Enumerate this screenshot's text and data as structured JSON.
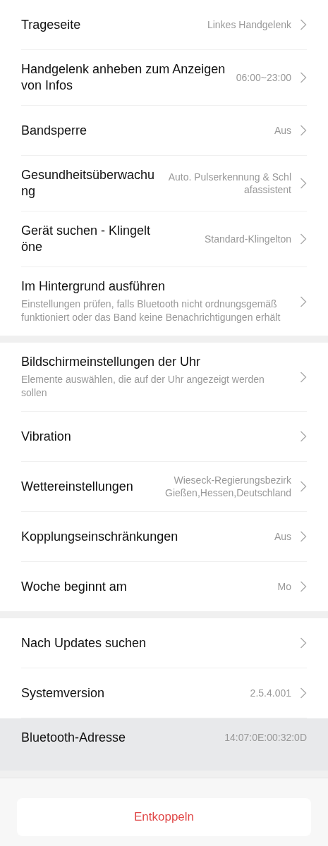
{
  "groups": [
    {
      "rows": [
        {
          "title": "Trageseite",
          "value": "Linkes Handgelenk",
          "chevron": true,
          "highlighted": false
        },
        {
          "title": "Handgelenk anheben zum Anzeigen von Infos",
          "value": "06:00~23:00",
          "chevron": true,
          "highlighted": false
        },
        {
          "title": "Bandsperre",
          "value": "Aus",
          "chevron": true,
          "highlighted": false
        },
        {
          "title": "Gesundheitsüberwachung",
          "value": "Auto. Pulserkennung & Schlafassistent",
          "chevron": true,
          "highlighted": false
        },
        {
          "title": "Gerät suchen - Klingeltöne",
          "value": "Standard-Klingelton",
          "chevron": true,
          "highlighted": false
        },
        {
          "title": "Im Hintergrund ausführen",
          "subtitle": "Einstellungen prüfen, falls Bluetooth nicht ordnungsgemäß funktioniert oder das Band keine Benachrichtigungen erhält",
          "chevron": true,
          "highlighted": false
        }
      ]
    },
    {
      "rows": [
        {
          "title": "Bildschirmeinstellungen der Uhr",
          "subtitle": "Elemente auswählen, die auf der Uhr angezeigt werden sollen",
          "chevron": true,
          "highlighted": false
        },
        {
          "title": "Vibration",
          "chevron": true,
          "highlighted": false
        },
        {
          "title": "Wettereinstellungen",
          "value": "Wieseck-Regierungsbezirk Gießen,Hessen,Deutschland",
          "chevron": true,
          "highlighted": false
        },
        {
          "title": "Kopplungseinschränkungen",
          "value": "Aus",
          "chevron": true,
          "highlighted": false
        },
        {
          "title": "Woche beginnt am",
          "value": "Mo",
          "chevron": true,
          "highlighted": false
        }
      ]
    },
    {
      "rows": [
        {
          "title": "Nach Updates suchen",
          "chevron": true,
          "highlighted": false
        },
        {
          "title": "Systemversion",
          "value": "2.5.4.001",
          "chevron": true,
          "highlighted": false
        },
        {
          "title": "Bluetooth-Adresse",
          "value": "14:07:0E:00:32:0D",
          "chevron": false,
          "highlighted": true
        }
      ]
    }
  ],
  "unpair_button": "Entkoppeln"
}
